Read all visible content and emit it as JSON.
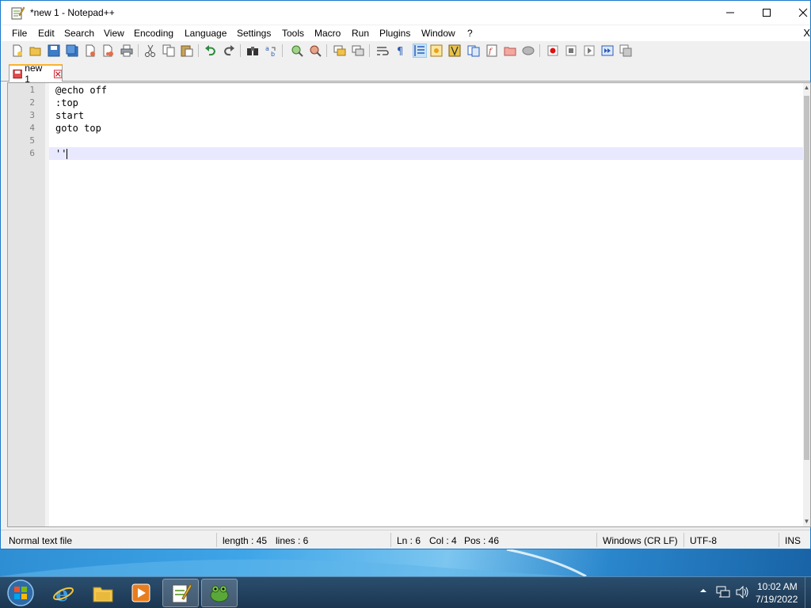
{
  "window": {
    "title": "*new 1 - Notepad++"
  },
  "menu": {
    "items": [
      "File",
      "Edit",
      "Search",
      "View",
      "Encoding",
      "Language",
      "Settings",
      "Tools",
      "Macro",
      "Run",
      "Plugins",
      "Window",
      "?"
    ],
    "close_glyph": "X"
  },
  "toolbar": {
    "icons": [
      "new-file-icon",
      "open-file-icon",
      "save-icon",
      "save-all-icon",
      "close-icon",
      "close-all-icon",
      "print-icon",
      "cut-icon",
      "copy-icon",
      "paste-icon",
      "undo-icon",
      "redo-icon",
      "find-icon",
      "replace-icon",
      "zoom-in-icon",
      "zoom-out-icon",
      "sync-vertical-icon",
      "sync-horizontal-icon",
      "word-wrap-icon",
      "show-all-characters-icon",
      "indent-guide-icon",
      "user-defined-language-icon",
      "document-map-icon",
      "document-list-icon",
      "function-list-icon",
      "folder-as-workspace-icon",
      "monitoring-icon",
      "record-macro-icon",
      "stop-recording-icon",
      "playback-macro-icon",
      "run-macro-multiple-icon",
      "save-macro-icon"
    ]
  },
  "tabs": [
    {
      "label": "new 1"
    }
  ],
  "editor": {
    "lines": [
      {
        "number": "1",
        "text": "@echo off"
      },
      {
        "number": "2",
        "text": ":top"
      },
      {
        "number": "3",
        "text": "start"
      },
      {
        "number": "4",
        "text": "goto top"
      },
      {
        "number": "5",
        "text": ""
      },
      {
        "number": "6",
        "text": "''"
      }
    ],
    "current_line": 6
  },
  "status": {
    "file_type": "Normal text file",
    "length": "length : 45",
    "lines": "lines : 6",
    "ln": "Ln : 6",
    "col": "Col : 4",
    "pos": "Pos : 46",
    "eol": "Windows (CR LF)",
    "encoding": "UTF-8",
    "mode": "INS"
  },
  "taskbar": {
    "clock_time": "10:02 AM",
    "clock_date": "7/19/2022"
  },
  "colors": {
    "current_line": "#e8e8ff",
    "tab_accent": "#fab32f",
    "taskbar": "#1b3651"
  }
}
